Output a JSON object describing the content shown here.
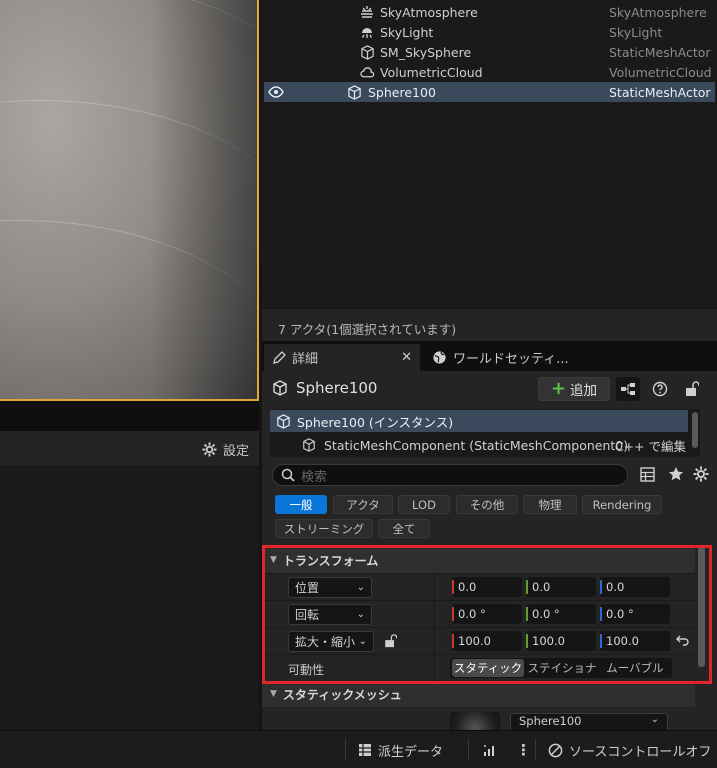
{
  "outliner": {
    "rows": [
      {
        "name": "SkyAtmosphere",
        "type": "SkyAtmosphere",
        "icon": "sky-atmosphere-icon"
      },
      {
        "name": "SkyLight",
        "type": "SkyLight",
        "icon": "sky-light-icon"
      },
      {
        "name": "SM_SkySphere",
        "type": "StaticMeshActor",
        "icon": "static-mesh-icon"
      },
      {
        "name": "VolumetricCloud",
        "type": "VolumetricCloud",
        "icon": "cloud-icon"
      },
      {
        "name": "Sphere100",
        "type": "StaticMeshActor",
        "icon": "static-mesh-icon",
        "selected": true
      }
    ],
    "status": "7 アクタ(1個選択されています)"
  },
  "left_panel": {
    "settings_label": "設定"
  },
  "tabs": [
    {
      "label": "詳細",
      "icon": "pencil-icon",
      "active": true
    },
    {
      "label": "ワールドセッティ...",
      "icon": "globe-icon",
      "active": false
    }
  ],
  "details": {
    "title": "Sphere100",
    "add_label": "追加",
    "instance_row": "Sphere100 (インスタンス)",
    "component_row": "StaticMeshComponent (StaticMeshComponent0)",
    "edit_cpp": "C++ で編集",
    "search_placeholder": "検索",
    "filters": [
      "一般",
      "アクタ",
      "LOD",
      "その他",
      "物理",
      "Rendering",
      "ストリーミング",
      "全て"
    ],
    "active_filter": "一般",
    "transform": {
      "header": "トランスフォーム",
      "location_label": "位置",
      "location": [
        "0.0",
        "0.0",
        "0.0"
      ],
      "rotation_label": "回転",
      "rotation": [
        "0.0 °",
        "0.0 °",
        "0.0 °"
      ],
      "scale_label": "拡大・縮小",
      "scale": [
        "100.0",
        "100.0",
        "100.0"
      ],
      "mobility_label": "可動性",
      "mobility_options": [
        "スタティック",
        "ステイショナ",
        "ムーバブル"
      ],
      "mobility_selected": "スタティック"
    },
    "static_mesh": {
      "header": "スタティックメッシュ",
      "asset": "Sphere100"
    }
  },
  "bottom_bar": {
    "derived_data": "派生データ",
    "source_control": "ソースコントロールオフ"
  },
  "colors": {
    "selection": "#3a4a5c",
    "accent": "#0a76d8",
    "highlight_box": "#e3242b",
    "x_axis": "#c8372c",
    "y_axis": "#5fa12c",
    "z_axis": "#2c6ad0"
  }
}
